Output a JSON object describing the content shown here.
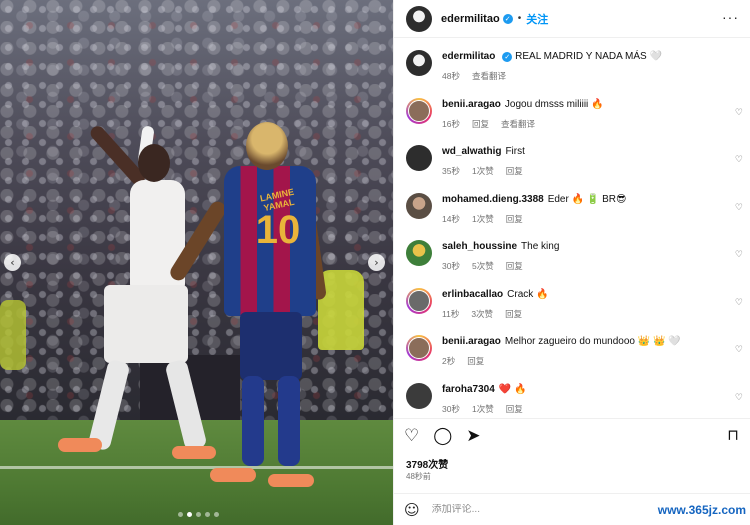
{
  "header": {
    "username": "edermilitao",
    "separator": "•",
    "follow_label": "关注",
    "more": "···"
  },
  "caption": {
    "username": "edermilitao",
    "text": "REAL MADRID Y NADA MÁS 🤍",
    "time": "48秒",
    "translate": "查看翻译"
  },
  "comments": [
    {
      "username": "benii.aragao",
      "text": "Jogou dmsss miliiii 🔥",
      "time": "16秒",
      "reply": "回复",
      "extra": "查看翻译",
      "avatar_color": "#8b6d5a",
      "story": true
    },
    {
      "username": "wd_alwathig",
      "text": "First",
      "time": "35秒",
      "likes": "1次赞",
      "reply": "回复",
      "avatar_color": "#2d2d2d",
      "story": false
    },
    {
      "username": "mohamed.dieng.3388",
      "text": "Eder 🔥 🔋 BR😎",
      "time": "14秒",
      "likes": "1次赞",
      "reply": "回复",
      "avatar_color": "#5a4e44",
      "story": false
    },
    {
      "username": "saleh_houssine",
      "text": "The king",
      "time": "30秒",
      "likes": "5次赞",
      "reply": "回复",
      "avatar_color": "#3e7f3a",
      "story": false
    },
    {
      "username": "erlinbacallao",
      "text": "Crack 🔥",
      "time": "11秒",
      "likes": "3次赞",
      "reply": "回复",
      "avatar_color": "#6a6a6a",
      "story": true
    },
    {
      "username": "benii.aragao",
      "text": "Melhor zagueiro do mundooo 👑 👑 🤍",
      "time": "2秒",
      "reply": "回复",
      "avatar_color": "#8b6d5a",
      "story": true
    },
    {
      "username": "faroha7304",
      "text": "❤️ 🔥",
      "time": "30秒",
      "likes": "1次赞",
      "reply": "回复",
      "avatar_color": "#3b3b3b",
      "story": false
    }
  ],
  "actions": {
    "like_icon": "♡",
    "comment_icon": "◯",
    "share_icon": "➤",
    "save_icon": "⊓"
  },
  "likes_count": "3798次赞",
  "post_time": "48秒前",
  "comment_input": {
    "placeholder": "添加评论...",
    "smile_icon": "☺"
  },
  "carousel": {
    "prev_icon": "‹",
    "next_icon": "›",
    "dots_total": 5,
    "active_dot": 1
  },
  "photo": {
    "shirt_number": "10",
    "shirt_name": "LAMINE YAMAL"
  },
  "watermark": "www.365jz.com"
}
